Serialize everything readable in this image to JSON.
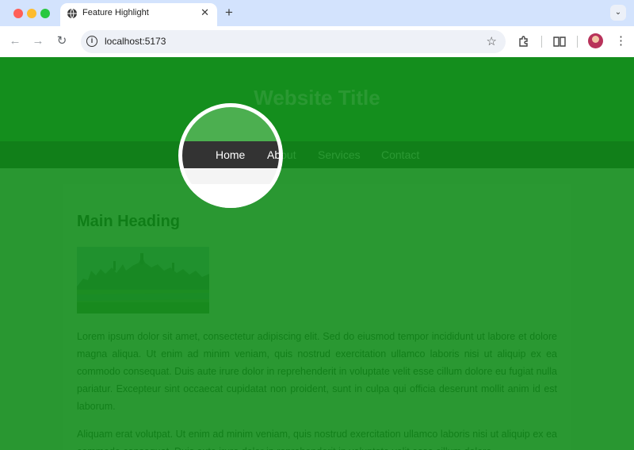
{
  "browser": {
    "tab_title": "Feature Highlight",
    "tab_close": "✕",
    "new_tab": "+",
    "tab_menu": "⌄",
    "url": "localhost:5173",
    "icons": [
      "globe-icon",
      "back-icon",
      "forward-icon",
      "reload-icon",
      "info-icon",
      "star-icon",
      "extensions-icon",
      "reading-list-icon",
      "avatar",
      "menu-icon"
    ]
  },
  "site": {
    "title": "Website Title",
    "nav": [
      "Home",
      "About",
      "Services",
      "Contact"
    ],
    "heading": "Main Heading",
    "paragraphs": [
      "Lorem ipsum dolor sit amet, consectetur adipiscing elit. Sed do eiusmod tempor incididunt ut labore et dolore magna aliqua. Ut enim ad minim veniam, quis nostrud exercitation ullamco laboris nisi ut aliquip ex ea commodo consequat. Duis aute irure dolor in reprehenderit in voluptate velit esse cillum dolore eu fugiat nulla pariatur. Excepteur sint occaecat cupidatat non proident, sunt in culpa qui officia deserunt mollit anim id est laborum.",
      "Aliquam erat volutpat. Ut enim ad minim veniam, quis nostrud exercitation ullamco laboris nisi ut aliquip ex ea commodo consequat. Duis aute irure dolor in reprehenderit in voluptate velit esse cillum dolore."
    ]
  },
  "colors": {
    "overlay": "#0c8a16",
    "header": "#4caf50",
    "nav": "#333333",
    "highlight_ring": "#ffffff"
  }
}
